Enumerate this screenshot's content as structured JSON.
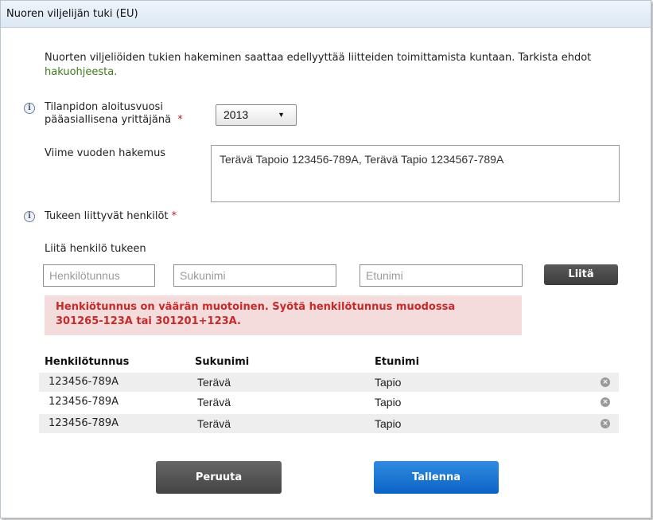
{
  "dialog": {
    "title": "Nuoren viljelijän tuki (EU)",
    "intro_text": "Nuorten viljeliöiden tukien hakeminen saattaa edellyyttää liitteiden toimittamista kuntaan. Tarkista ehdot",
    "intro_link": "hakuohjeesta."
  },
  "start_year": {
    "label_line1": "Tilanpidon aloitusvuosi",
    "label_line2": "pääasiallisena yrittäjänä",
    "required_mark": "*",
    "selected": "2013",
    "caret": "▼"
  },
  "last_year": {
    "label": "Viime vuoden hakemus",
    "value": "Terävä Tapoio 123456-789A, Terävä Tapio 1234567-789A"
  },
  "persons": {
    "label": "Tukeen liittyvät henkilöt",
    "required_mark": "*",
    "attach_label": "Liitä henkilö tukeen",
    "ssn_placeholder": "Henkilötunnus",
    "surname_placeholder": "Sukunimi",
    "firstname_placeholder": "Etunimi",
    "attach_button": "Liitä",
    "error_line1": "Henkiötunnus on väärän muotoinen. Syötä henkilötunnus muodossa",
    "error_line2": "301265-123A tai 301201+123A.",
    "headers": [
      "Henkilötunnus",
      "Sukunimi",
      "Etunimi"
    ],
    "rows": [
      {
        "ssn": "123456-789A",
        "surname": "Terävä",
        "firstname": "Tapio"
      },
      {
        "ssn": "123456-789A",
        "surname": "Terävä",
        "firstname": "Tapio"
      },
      {
        "ssn": "123456-789A",
        "surname": "Terävä",
        "firstname": "Tapio"
      }
    ]
  },
  "icons": {
    "info": "i",
    "remove": "×"
  },
  "buttons": {
    "cancel": "Peruuta",
    "save": "Tallenna"
  },
  "colors": {
    "save_button": "#1e74d2",
    "cancel_button": "#555555",
    "error_bg": "#f4dcdc",
    "error_text": "#c62a2a",
    "link": "#3f7a1c"
  }
}
